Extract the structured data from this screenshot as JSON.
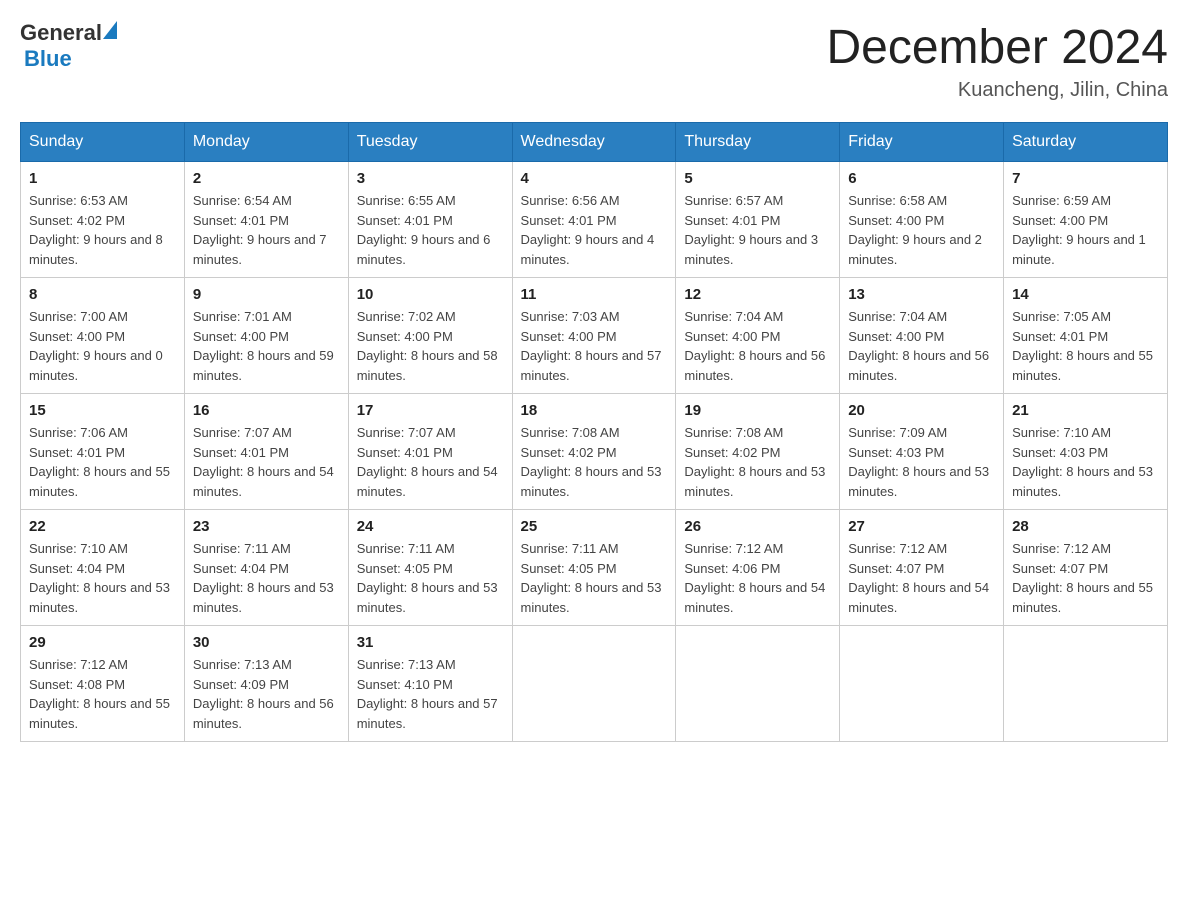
{
  "header": {
    "logo_general": "General",
    "logo_blue": "Blue",
    "month_title": "December 2024",
    "location": "Kuancheng, Jilin, China"
  },
  "days_of_week": [
    "Sunday",
    "Monday",
    "Tuesday",
    "Wednesday",
    "Thursday",
    "Friday",
    "Saturday"
  ],
  "weeks": [
    [
      {
        "day": "1",
        "sunrise": "6:53 AM",
        "sunset": "4:02 PM",
        "daylight": "9 hours and 8 minutes."
      },
      {
        "day": "2",
        "sunrise": "6:54 AM",
        "sunset": "4:01 PM",
        "daylight": "9 hours and 7 minutes."
      },
      {
        "day": "3",
        "sunrise": "6:55 AM",
        "sunset": "4:01 PM",
        "daylight": "9 hours and 6 minutes."
      },
      {
        "day": "4",
        "sunrise": "6:56 AM",
        "sunset": "4:01 PM",
        "daylight": "9 hours and 4 minutes."
      },
      {
        "day": "5",
        "sunrise": "6:57 AM",
        "sunset": "4:01 PM",
        "daylight": "9 hours and 3 minutes."
      },
      {
        "day": "6",
        "sunrise": "6:58 AM",
        "sunset": "4:00 PM",
        "daylight": "9 hours and 2 minutes."
      },
      {
        "day": "7",
        "sunrise": "6:59 AM",
        "sunset": "4:00 PM",
        "daylight": "9 hours and 1 minute."
      }
    ],
    [
      {
        "day": "8",
        "sunrise": "7:00 AM",
        "sunset": "4:00 PM",
        "daylight": "9 hours and 0 minutes."
      },
      {
        "day": "9",
        "sunrise": "7:01 AM",
        "sunset": "4:00 PM",
        "daylight": "8 hours and 59 minutes."
      },
      {
        "day": "10",
        "sunrise": "7:02 AM",
        "sunset": "4:00 PM",
        "daylight": "8 hours and 58 minutes."
      },
      {
        "day": "11",
        "sunrise": "7:03 AM",
        "sunset": "4:00 PM",
        "daylight": "8 hours and 57 minutes."
      },
      {
        "day": "12",
        "sunrise": "7:04 AM",
        "sunset": "4:00 PM",
        "daylight": "8 hours and 56 minutes."
      },
      {
        "day": "13",
        "sunrise": "7:04 AM",
        "sunset": "4:00 PM",
        "daylight": "8 hours and 56 minutes."
      },
      {
        "day": "14",
        "sunrise": "7:05 AM",
        "sunset": "4:01 PM",
        "daylight": "8 hours and 55 minutes."
      }
    ],
    [
      {
        "day": "15",
        "sunrise": "7:06 AM",
        "sunset": "4:01 PM",
        "daylight": "8 hours and 55 minutes."
      },
      {
        "day": "16",
        "sunrise": "7:07 AM",
        "sunset": "4:01 PM",
        "daylight": "8 hours and 54 minutes."
      },
      {
        "day": "17",
        "sunrise": "7:07 AM",
        "sunset": "4:01 PM",
        "daylight": "8 hours and 54 minutes."
      },
      {
        "day": "18",
        "sunrise": "7:08 AM",
        "sunset": "4:02 PM",
        "daylight": "8 hours and 53 minutes."
      },
      {
        "day": "19",
        "sunrise": "7:08 AM",
        "sunset": "4:02 PM",
        "daylight": "8 hours and 53 minutes."
      },
      {
        "day": "20",
        "sunrise": "7:09 AM",
        "sunset": "4:03 PM",
        "daylight": "8 hours and 53 minutes."
      },
      {
        "day": "21",
        "sunrise": "7:10 AM",
        "sunset": "4:03 PM",
        "daylight": "8 hours and 53 minutes."
      }
    ],
    [
      {
        "day": "22",
        "sunrise": "7:10 AM",
        "sunset": "4:04 PM",
        "daylight": "8 hours and 53 minutes."
      },
      {
        "day": "23",
        "sunrise": "7:11 AM",
        "sunset": "4:04 PM",
        "daylight": "8 hours and 53 minutes."
      },
      {
        "day": "24",
        "sunrise": "7:11 AM",
        "sunset": "4:05 PM",
        "daylight": "8 hours and 53 minutes."
      },
      {
        "day": "25",
        "sunrise": "7:11 AM",
        "sunset": "4:05 PM",
        "daylight": "8 hours and 53 minutes."
      },
      {
        "day": "26",
        "sunrise": "7:12 AM",
        "sunset": "4:06 PM",
        "daylight": "8 hours and 54 minutes."
      },
      {
        "day": "27",
        "sunrise": "7:12 AM",
        "sunset": "4:07 PM",
        "daylight": "8 hours and 54 minutes."
      },
      {
        "day": "28",
        "sunrise": "7:12 AM",
        "sunset": "4:07 PM",
        "daylight": "8 hours and 55 minutes."
      }
    ],
    [
      {
        "day": "29",
        "sunrise": "7:12 AM",
        "sunset": "4:08 PM",
        "daylight": "8 hours and 55 minutes."
      },
      {
        "day": "30",
        "sunrise": "7:13 AM",
        "sunset": "4:09 PM",
        "daylight": "8 hours and 56 minutes."
      },
      {
        "day": "31",
        "sunrise": "7:13 AM",
        "sunset": "4:10 PM",
        "daylight": "8 hours and 57 minutes."
      },
      null,
      null,
      null,
      null
    ]
  ],
  "labels": {
    "sunrise": "Sunrise:",
    "sunset": "Sunset:",
    "daylight": "Daylight:"
  }
}
